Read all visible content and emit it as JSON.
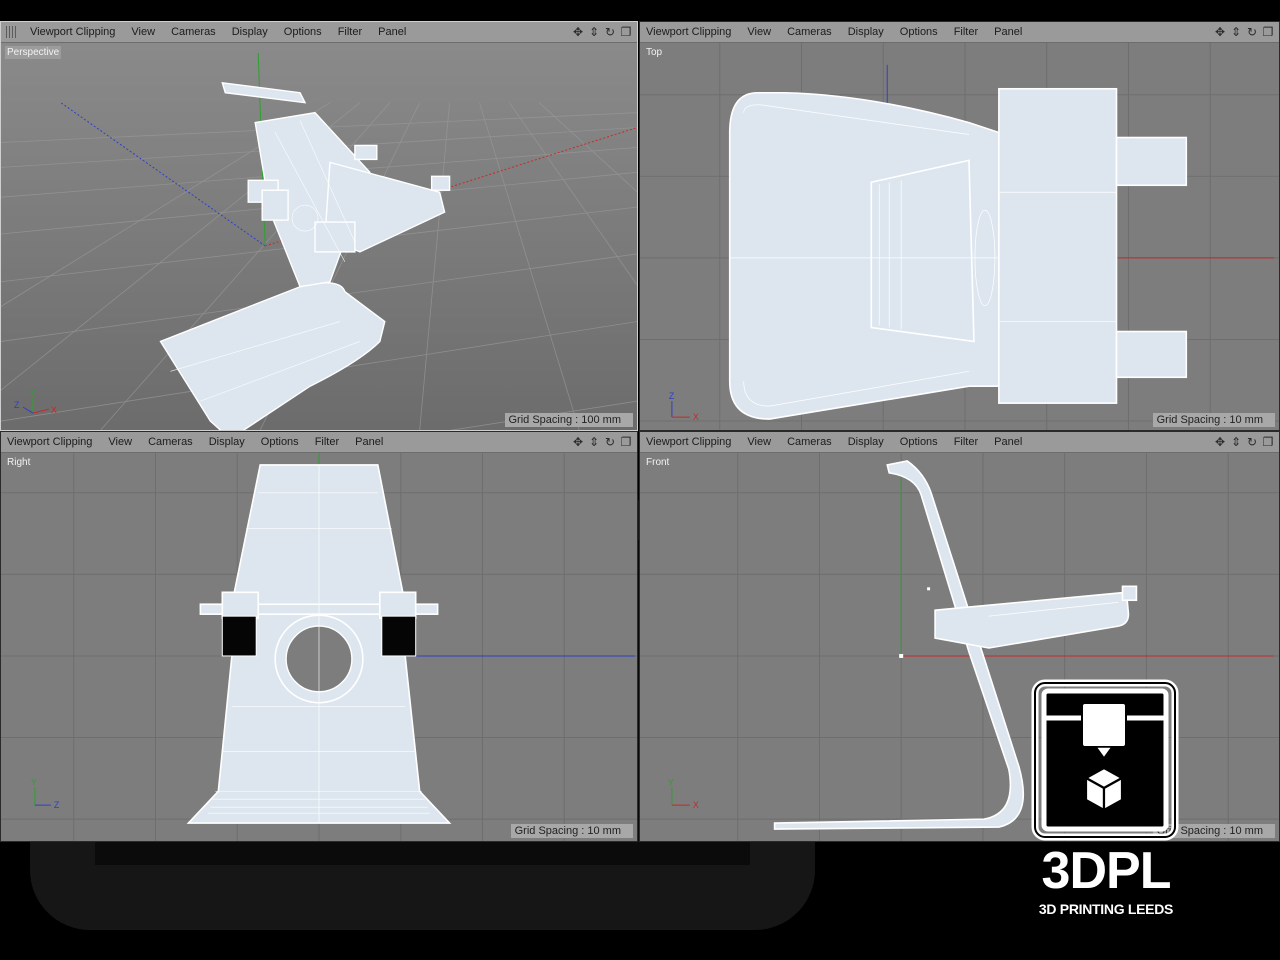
{
  "menu": {
    "viewport_clipping": "Viewport Clipping",
    "view": "View",
    "cameras": "Cameras",
    "display": "Display",
    "options": "Options",
    "filter": "Filter",
    "panel": "Panel"
  },
  "viewports": {
    "perspective": {
      "name": "Perspective",
      "grid_spacing": "Grid Spacing : 100 mm"
    },
    "top": {
      "name": "Top",
      "grid_spacing": "Grid Spacing : 10 mm"
    },
    "right": {
      "name": "Right",
      "grid_spacing": "Grid Spacing : 10 mm"
    },
    "front": {
      "name": "Front",
      "grid_spacing": "Grid Spacing : 10 mm"
    }
  },
  "axes": {
    "x": "X",
    "y": "Y",
    "z": "Z"
  },
  "tool_icons": [
    "move-view-icon",
    "dolly-view-icon",
    "rotate-view-icon",
    "maximize-view-icon"
  ],
  "brand": {
    "title": "3DPL",
    "subtitle": "3D PRINTING LEEDS"
  },
  "colors": {
    "viewport_bg": "#7d7d7d",
    "menubar": "#9a9a9a",
    "axis_x": "#c62a2a",
    "axis_y": "#2fa02f",
    "axis_z": "#2f3fc6",
    "model_fill": "#dde6ef",
    "model_edge": "#ffffff"
  }
}
